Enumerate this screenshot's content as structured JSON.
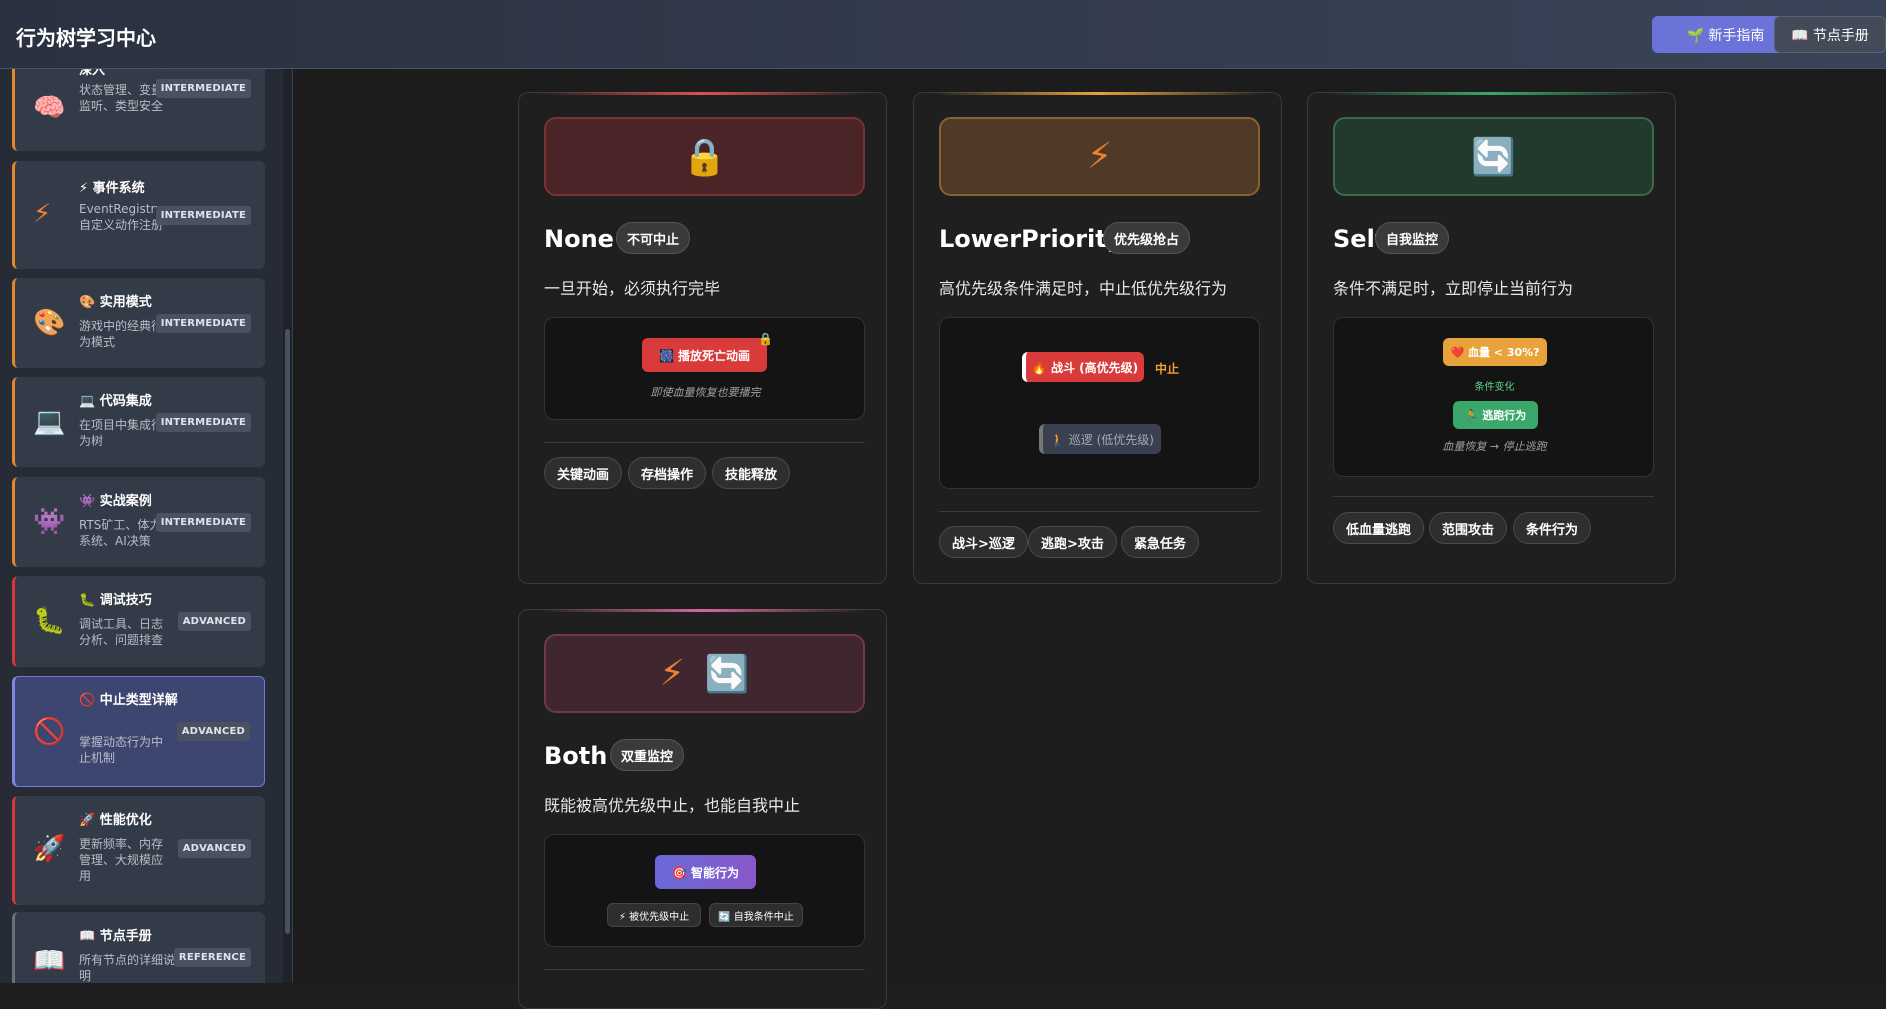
{
  "header": {
    "title": "行为树学习中心",
    "guide_button": "🌱 新手指南",
    "manual_button": "📖 节点手册"
  },
  "sidebar": {
    "items": [
      {
        "icon": "🧠",
        "title": "深入",
        "desc": "状态管理、变量监听、类型安全",
        "level": "INTERMEDIATE"
      },
      {
        "icon": "⚡",
        "title": "⚡ 事件系统",
        "desc": "EventRegistry、自定义动作注册",
        "level": "INTERMEDIATE"
      },
      {
        "icon": "🎨",
        "title": "🎨 实用模式",
        "desc": "游戏中的经典行为模式",
        "level": "INTERMEDIATE"
      },
      {
        "icon": "💻",
        "title": "💻 代码集成",
        "desc": "在项目中集成行为树",
        "level": "INTERMEDIATE"
      },
      {
        "icon": "👾",
        "title": "👾 实战案例",
        "desc": "RTS矿工、体力系统、AI决策",
        "level": "INTERMEDIATE"
      },
      {
        "icon": "🐛",
        "title": "🐛 调试技巧",
        "desc": "调试工具、日志分析、问题排查",
        "level": "ADVANCED"
      },
      {
        "icon": "🚫",
        "title": "🚫 中止类型详解",
        "desc": "掌握动态行为中止机制",
        "level": "ADVANCED"
      },
      {
        "icon": "🚀",
        "title": "🚀 性能优化",
        "desc": "更新频率、内存管理、大规模应用",
        "level": "ADVANCED"
      },
      {
        "icon": "📖",
        "title": "📖 节点手册",
        "desc": "所有节点的详细说明",
        "level": "REFERENCE"
      }
    ]
  },
  "cards": {
    "none": {
      "icon": "🔒",
      "name": "None",
      "badge": "不可中止",
      "lead": "一旦开始，必须执行完毕",
      "node": "🎆 播放死亡动画",
      "lock": "🔒",
      "note": "即使血量恢复也要播完",
      "tags": [
        "关键动画",
        "存档操作",
        "技能释放"
      ],
      "accent": "#d9534f"
    },
    "lower": {
      "icon": "⚡",
      "name": "LowerPriority",
      "badge": "优先级抢占",
      "lead": "高优先级条件满足时，中止低优先级行为",
      "node_high": "🔥 战斗 (高优先级)",
      "abort": "中止",
      "node_low": "🚶 巡逻 (低优先级)",
      "tags": [
        "战斗>巡逻",
        "逃跑>攻击",
        "紧急任务"
      ],
      "accent": "#e8a23a"
    },
    "self": {
      "icon": "🔄",
      "name": "Self",
      "badge": "自我监控",
      "lead": "条件不满足时，立即停止当前行为",
      "condition": "❤️ 血量 < 30%?",
      "change": "条件变化",
      "node": "🏃 逃跑行为",
      "note": "血量恢复 → 停止逃跑",
      "tags": [
        "低血量逃跑",
        "范围攻击",
        "条件行为"
      ],
      "accent": "#3aa86a"
    },
    "both": {
      "icon1": "⚡",
      "icon2": "🔄",
      "name": "Both",
      "badge": "双重监控",
      "lead": "既能被高优先级中止，也能自我中止",
      "node": "🎯 智能行为",
      "sub1": "⚡ 被优先级中止",
      "sub2": "🔄 自我条件中止",
      "accent": "#d06a9a"
    }
  }
}
